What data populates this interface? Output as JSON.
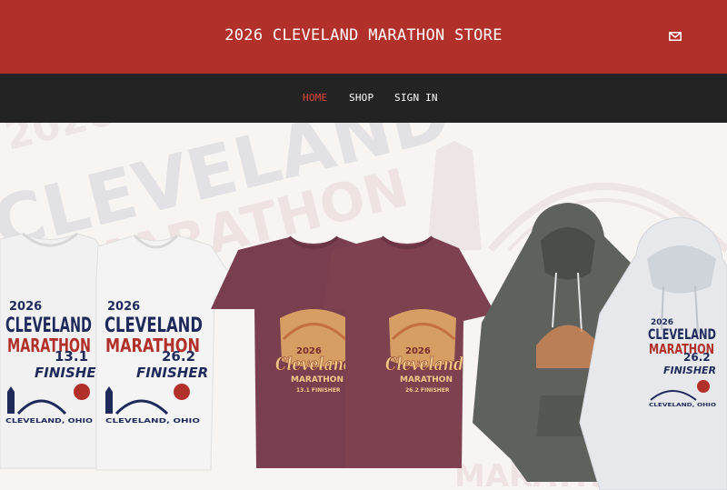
{
  "header": {
    "title": "2026 CLEVELAND MARATHON STORE",
    "mail_icon": "envelope-icon",
    "color": "#b2302a"
  },
  "nav": {
    "items": [
      {
        "label": "HOME",
        "active": true
      },
      {
        "label": "SHOP",
        "active": false
      },
      {
        "label": "SIGN IN",
        "active": false
      }
    ],
    "color": "#232323",
    "active_color": "#e0473d"
  },
  "hero": {
    "background_text": [
      "2026",
      "CLEVELAND",
      "MARATHON"
    ],
    "products": [
      {
        "name": "white-tee-half",
        "year": "2026",
        "line1": "CLEVELAND",
        "line2": "MARATHON",
        "distance": "13.1",
        "label": "FINISHER",
        "location": "CLEVELAND, OHIO",
        "color": "#f0f0f0"
      },
      {
        "name": "white-tee-full",
        "year": "2026",
        "line1": "CLEVELAND",
        "line2": "MARATHON",
        "distance": "26.2",
        "label": "FINISHER",
        "location": "CLEVELAND, OHIO",
        "color": "#f0f0f0"
      },
      {
        "name": "maroon-tee-half",
        "year": "2026",
        "line1": "Cleveland",
        "line2": "MARATHON",
        "sub": "13.1 FINISHER",
        "color": "#7a3f4f"
      },
      {
        "name": "maroon-tee-full",
        "year": "2026",
        "line1": "Cleveland",
        "line2": "MARATHON",
        "sub": "26.2 FINISHER",
        "color": "#7d4150"
      },
      {
        "name": "gray-hoodie",
        "color": "#5f615c"
      },
      {
        "name": "white-hoodie",
        "year": "2026",
        "line1": "CLEVELAND",
        "line2": "MARATHON",
        "distance": "26.2",
        "label": "FINISHER",
        "location": "CLEVELAND, OHIO",
        "color": "#e6e8ec"
      }
    ]
  }
}
